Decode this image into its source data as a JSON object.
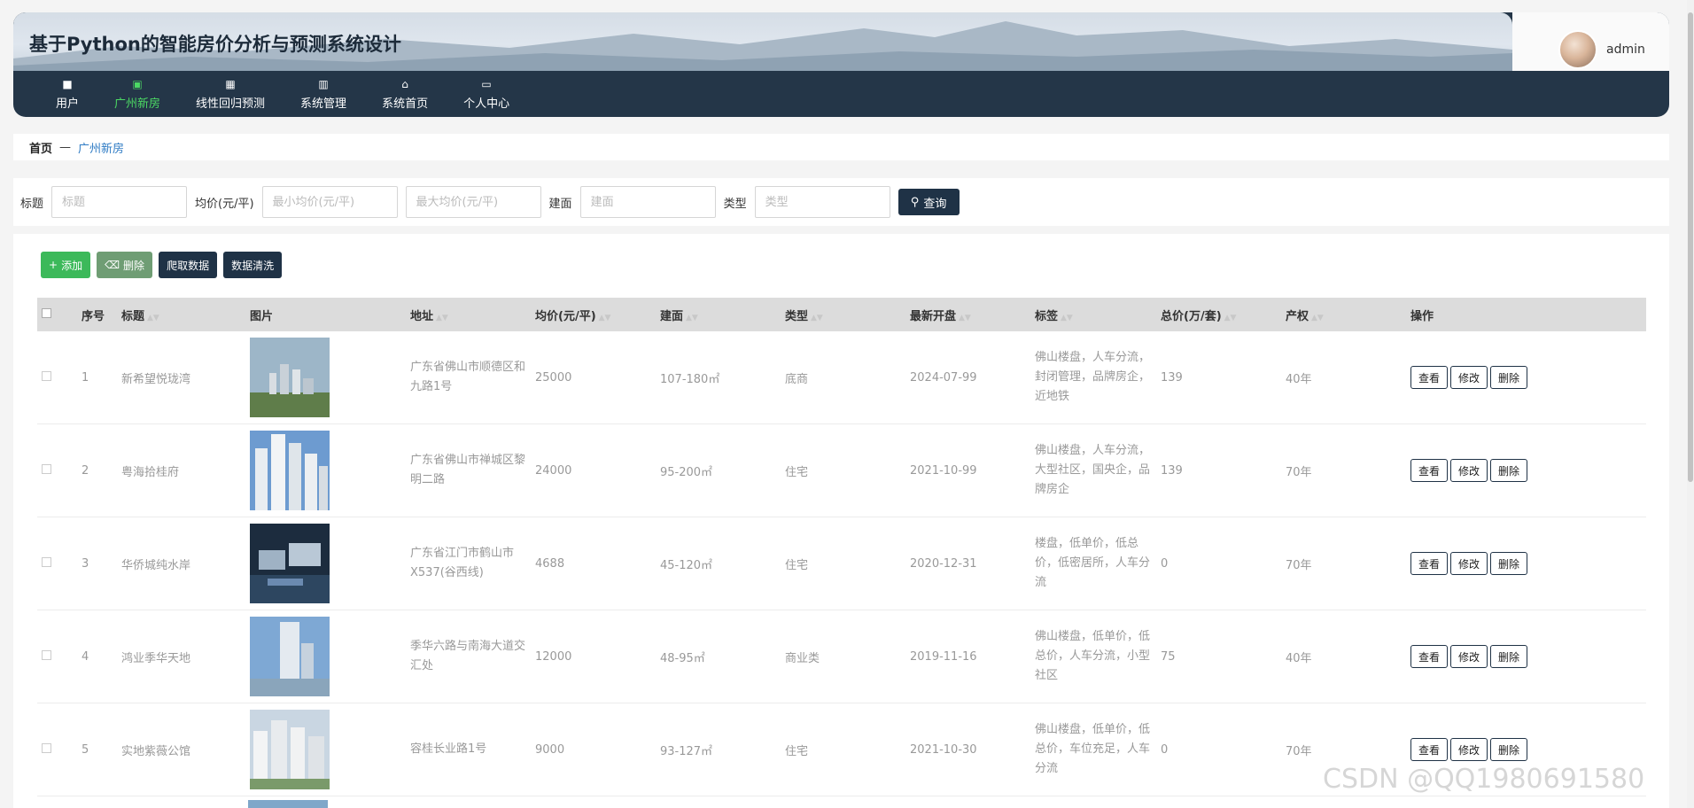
{
  "app": {
    "title": "基于Python的智能房价分析与预测系统设计",
    "username": "admin"
  },
  "nav": [
    {
      "label": "用户",
      "icon": "user-icon",
      "glyph": "■"
    },
    {
      "label": "广州新房",
      "icon": "house-list-icon",
      "glyph": "▣"
    },
    {
      "label": "线性回归预测",
      "icon": "grid-icon",
      "glyph": "▦"
    },
    {
      "label": "系统管理",
      "icon": "chart-icon",
      "glyph": "▥"
    },
    {
      "label": "系统首页",
      "icon": "home-icon",
      "glyph": "⌂"
    },
    {
      "label": "个人中心",
      "icon": "profile-icon",
      "glyph": "▭"
    }
  ],
  "breadcrumb": {
    "home": "首页",
    "sep": "—",
    "current": "广州新房"
  },
  "search": {
    "title_label": "标题",
    "title_placeholder": "标题",
    "price_label": "均价(元/平)",
    "min_price_placeholder": "最小均价(元/平)",
    "max_price_placeholder": "最大均价(元/平)",
    "area_label": "建面",
    "area_placeholder": "建面",
    "type_label": "类型",
    "type_placeholder": "类型",
    "query_label": "查询"
  },
  "actions": {
    "add": "添加",
    "delete": "删除",
    "crawl": "爬取数据",
    "clean": "数据清洗"
  },
  "columns": [
    "序号",
    "标题",
    "图片",
    "地址",
    "均价(元/平)",
    "建面",
    "类型",
    "最新开盘",
    "标签",
    "总价(万/套)",
    "产权",
    "操作"
  ],
  "row_buttons": {
    "view": "查看",
    "edit": "修改",
    "delete": "删除"
  },
  "rows": [
    {
      "no": "1",
      "title": "新希望悦珑湾",
      "address": "广东省佛山市顺德区和九路1号",
      "price": "25000",
      "area": "107-180㎡",
      "type": "底商",
      "opening": "2024-07-99",
      "tags": "佛山楼盘，人车分流，封闭管理，品牌房企，近地铁",
      "total": "139",
      "right": "40年",
      "img": "img-a"
    },
    {
      "no": "2",
      "title": "粤海拾桂府",
      "address": "广东省佛山市禅城区黎明二路",
      "price": "24000",
      "area": "95-200㎡",
      "type": "住宅",
      "opening": "2021-10-99",
      "tags": "佛山楼盘，人车分流，大型社区，国央企，品牌房企",
      "total": "139",
      "right": "70年",
      "img": "img-b"
    },
    {
      "no": "3",
      "title": "华侨城纯水岸",
      "address": "广东省江门市鹤山市X537(谷西线)",
      "price": "4688",
      "area": "45-120㎡",
      "type": "住宅",
      "opening": "2020-12-31",
      "tags": "楼盘，低单价，低总价，低密居所，人车分流",
      "total": "0",
      "right": "70年",
      "img": "img-c"
    },
    {
      "no": "4",
      "title": "鸿业季华天地",
      "address": "季华六路与南海大道交汇处",
      "price": "12000",
      "area": "48-95㎡",
      "type": "商业类",
      "opening": "2019-11-16",
      "tags": "佛山楼盘，低单价，低总价，人车分流，小型社区",
      "total": "75",
      "right": "40年",
      "img": "img-d"
    },
    {
      "no": "5",
      "title": "实地紫薇公馆",
      "address": "容桂长业路1号",
      "price": "9000",
      "area": "93-127㎡",
      "type": "住宅",
      "opening": "2021-10-30",
      "tags": "佛山楼盘，低单价，低总价，车位充足，人车分流",
      "total": "0",
      "right": "70年",
      "img": "img-e"
    }
  ],
  "watermark": "CSDN @QQ1980691580"
}
